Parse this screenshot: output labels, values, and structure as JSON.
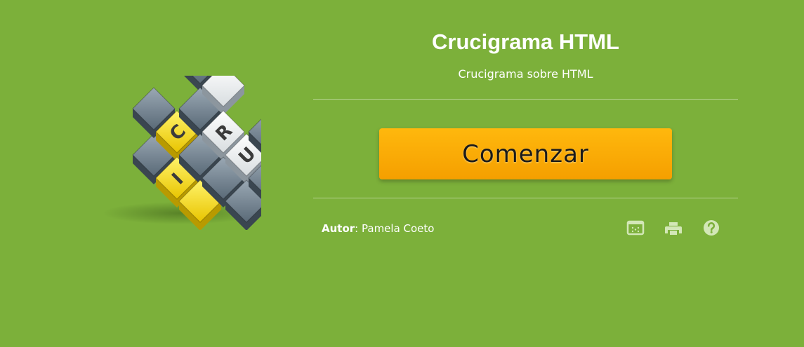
{
  "activity": {
    "title": "Crucigrama HTML",
    "subtitle": "Crucigrama sobre HTML",
    "start_label": "Comenzar",
    "author_label": "Autor",
    "author_separator": ": ",
    "author_name": "Pamela Coeto"
  },
  "logo": {
    "letters": [
      "C",
      "R",
      "U",
      "I"
    ]
  },
  "toolbar": {
    "icons": [
      "fullscreen-icon",
      "print-icon",
      "help-icon"
    ]
  },
  "colors": {
    "background": "#7cb03a",
    "button": "#f7a600",
    "text": "#ffffff"
  }
}
